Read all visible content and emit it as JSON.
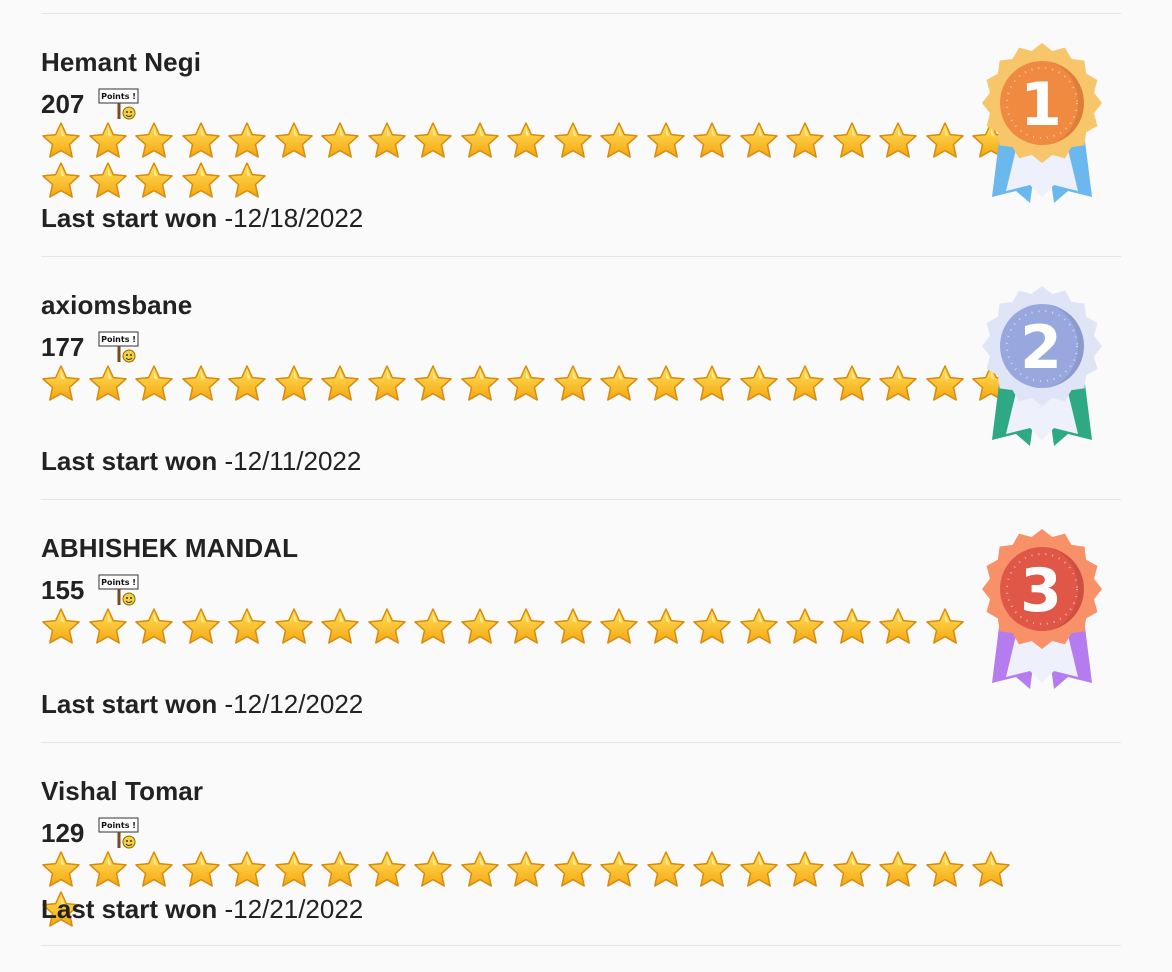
{
  "points_icon": {
    "name": "points-sign-icon",
    "text": "Points !"
  },
  "entries": [
    {
      "name": "Hemant Negi",
      "points": "207",
      "stars": 26,
      "last_won_label": "Last start won",
      "last_won_date": "-12/18/2022",
      "medal": {
        "rank": "1",
        "ribbon": "#6bb8ee",
        "ring": "#f7c66b",
        "disc": "#f08a40"
      }
    },
    {
      "name": "axiomsbane",
      "points": "177",
      "stars": 21,
      "last_won_label": "Last start won",
      "last_won_date": "-12/11/2022",
      "medal": {
        "rank": "2",
        "ribbon": "#2fa884",
        "ring": "#dfe4f7",
        "disc": "#98a8de"
      }
    },
    {
      "name": "ABHISHEK MANDAL",
      "points": "155",
      "stars": 20,
      "last_won_label": "Last start won",
      "last_won_date": "-12/12/2022",
      "medal": {
        "rank": "3",
        "ribbon": "#b57cf0",
        "ring": "#f89068",
        "disc": "#e05748"
      }
    },
    {
      "name": "Vishal Tomar",
      "points": "129",
      "stars": 22,
      "last_won_label": "Last start won",
      "last_won_date": "-12/21/2022",
      "medal": null
    }
  ]
}
